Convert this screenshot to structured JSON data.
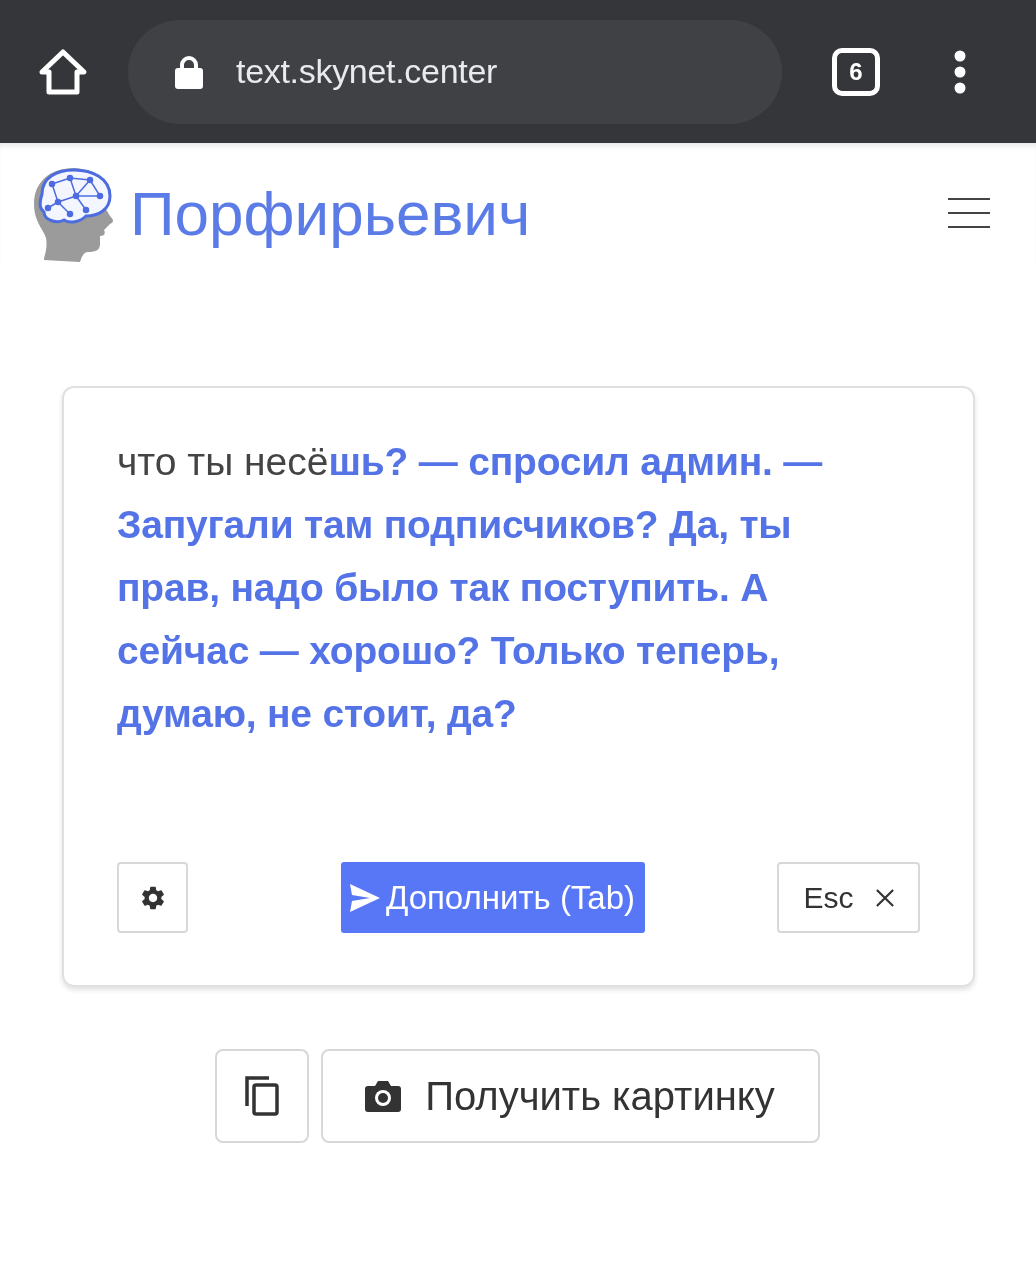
{
  "browser_bar": {
    "url": "text.skynet.center",
    "tab_count": "6"
  },
  "header": {
    "title": "Порфирьевич"
  },
  "editor": {
    "text": "что ты несё**шь? — спросил админ. — Запугали там подписчиков? Да, ты прав, надо было так поступить. А сейчас — хорошо? Только теперь, думаю, не стоит, да?**",
    "generate_button": "Дополнить (Tab)",
    "cancel_button": "Esc"
  },
  "actions": {
    "image_button": "Получить картинку"
  }
}
